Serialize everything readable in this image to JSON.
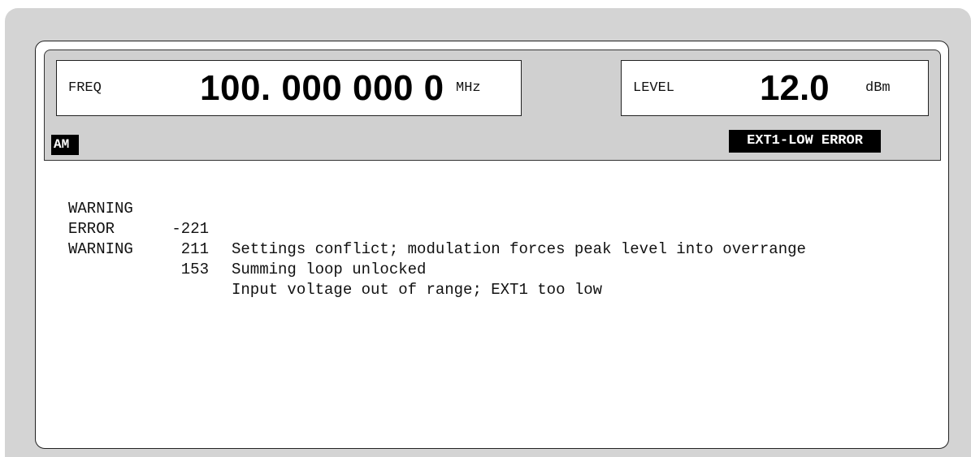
{
  "freq": {
    "label": "FREQ",
    "value": "100. 000 000 0",
    "unit": "MHz"
  },
  "level": {
    "label": "LEVEL",
    "value": "12.0",
    "unit": "dBm"
  },
  "status": {
    "modulation_badge": "AM",
    "error_badge": "EXT1-LOW ERROR"
  },
  "messages": [
    {
      "type": "WARNING",
      "code": "-221",
      "text": "Settings conflict; modulation forces peak level into overrange"
    },
    {
      "type": "ERROR",
      "code": "211",
      "text": "Summing loop unlocked"
    },
    {
      "type": "WARNING",
      "code": "153",
      "text": "Input voltage out of range; EXT1 too low"
    }
  ],
  "colors": {
    "bezel": "#d4d4d4",
    "header": "#d0d0d0",
    "badge_bg": "#000000",
    "badge_fg": "#ffffff"
  }
}
